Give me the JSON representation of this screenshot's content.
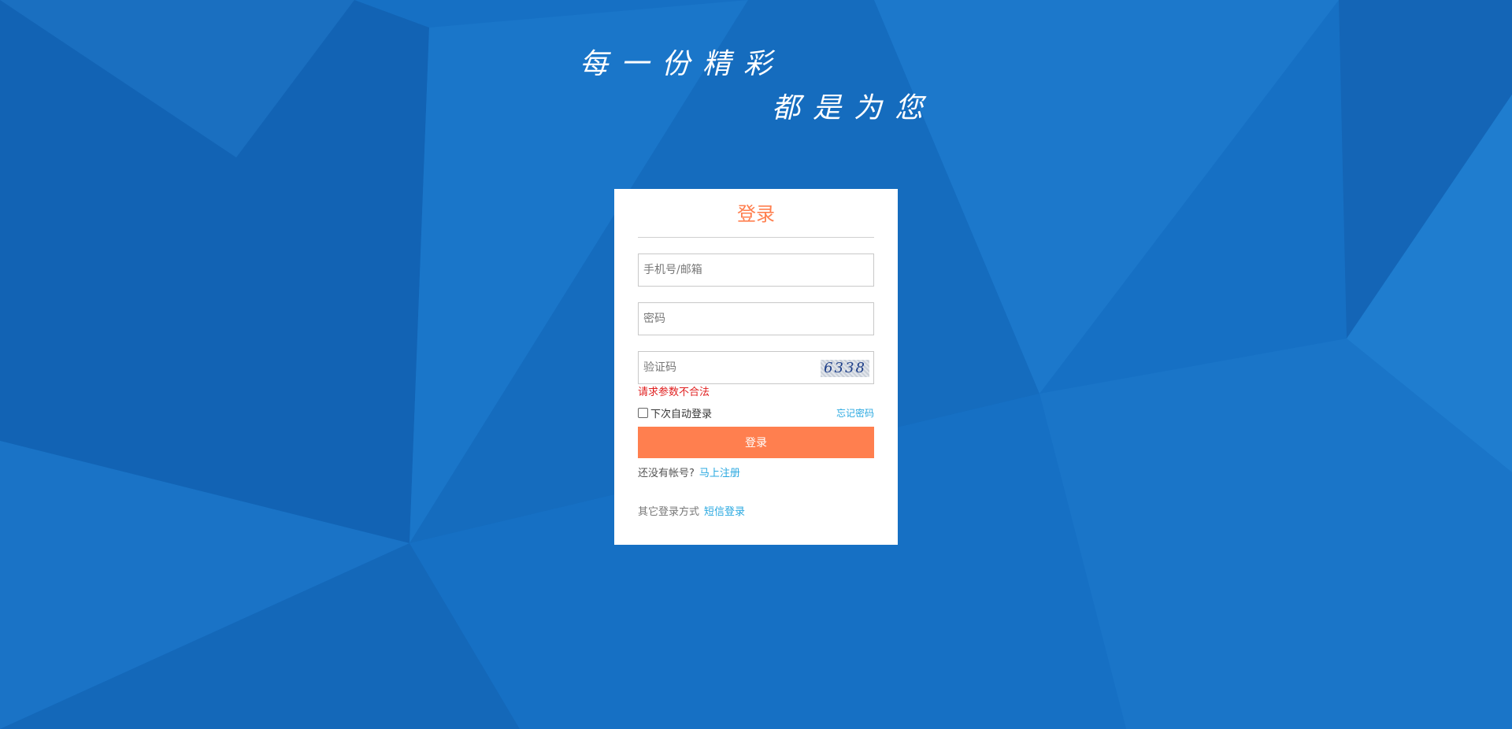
{
  "slogan": {
    "line1": "每一份精彩",
    "line2": "都是为您"
  },
  "login_form": {
    "title": "登录",
    "account_placeholder": "手机号/邮箱",
    "password_placeholder": "密码",
    "captcha_placeholder": "验证码",
    "captcha_code": "6338",
    "error_message": "请求参数不合法",
    "remember_label": "下次自动登录",
    "forgot_link": "忘记密码",
    "submit_label": "登录",
    "register_prompt": "还没有帐号?",
    "register_link": "马上注册",
    "other_login_label": "其它登录方式",
    "sms_login_link": "短信登录"
  },
  "colors": {
    "background": "#1670c4",
    "accent": "#ff7f4f",
    "link": "#29a8e0",
    "error": "#e02020"
  }
}
